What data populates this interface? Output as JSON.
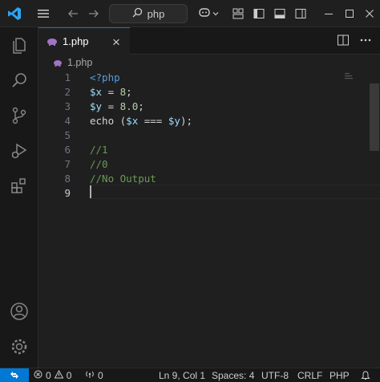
{
  "titlebar": {
    "search_text": "php",
    "icons": [
      "vscode-logo-icon",
      "menu-icon",
      "back-arrow-icon",
      "forward-arrow-icon",
      "search-icon",
      "copilot-icon",
      "chevron-down-icon",
      "layout-customize-icon",
      "toggle-sidebar-icon",
      "toggle-panel-icon",
      "toggle-secondary-sidebar-icon"
    ]
  },
  "activitybar": {
    "items": [
      "explorer-icon",
      "search-icon",
      "source-control-icon",
      "run-debug-icon",
      "extensions-icon"
    ],
    "bottom": [
      "accounts-icon",
      "settings-gear-icon"
    ]
  },
  "tab": {
    "label": "1.php",
    "icon": "php-elephant-icon",
    "close": "×"
  },
  "breadcrumb": {
    "file": "1.php"
  },
  "editor": {
    "lines": [
      {
        "n": "1",
        "tokens": [
          {
            "t": "<?php",
            "c": "kw"
          }
        ]
      },
      {
        "n": "2",
        "tokens": [
          {
            "t": "$x",
            "c": "var"
          },
          {
            "t": " = ",
            "c": "plain"
          },
          {
            "t": "8",
            "c": "num"
          },
          {
            "t": ";",
            "c": "plain"
          }
        ]
      },
      {
        "n": "3",
        "tokens": [
          {
            "t": "$y",
            "c": "var"
          },
          {
            "t": " = ",
            "c": "plain"
          },
          {
            "t": "8.0",
            "c": "num"
          },
          {
            "t": ";",
            "c": "plain"
          }
        ]
      },
      {
        "n": "4",
        "tokens": [
          {
            "t": "echo",
            "c": "plain"
          },
          {
            "t": " (",
            "c": "plain"
          },
          {
            "t": "$x",
            "c": "var"
          },
          {
            "t": " === ",
            "c": "plain"
          },
          {
            "t": "$y",
            "c": "var"
          },
          {
            "t": ");",
            "c": "plain"
          }
        ]
      },
      {
        "n": "5",
        "tokens": []
      },
      {
        "n": "6",
        "tokens": [
          {
            "t": "//1",
            "c": "comment"
          }
        ]
      },
      {
        "n": "7",
        "tokens": [
          {
            "t": "//0",
            "c": "comment"
          }
        ]
      },
      {
        "n": "8",
        "tokens": [
          {
            "t": "//No Output",
            "c": "comment"
          }
        ]
      },
      {
        "n": "9",
        "tokens": [],
        "active": true
      }
    ]
  },
  "statusbar": {
    "errors": "0",
    "warnings": "0",
    "ports": "0",
    "position": "Ln 9, Col 1",
    "spaces": "Spaces: 4",
    "encoding": "UTF-8",
    "eol": "CRLF",
    "language": "PHP"
  },
  "colors": {
    "accent": "#0078d4",
    "background": "#1f1f1f",
    "comment": "#6a9955",
    "keyword": "#569cd6",
    "variable": "#9cdcfe",
    "number": "#b5cea8"
  }
}
